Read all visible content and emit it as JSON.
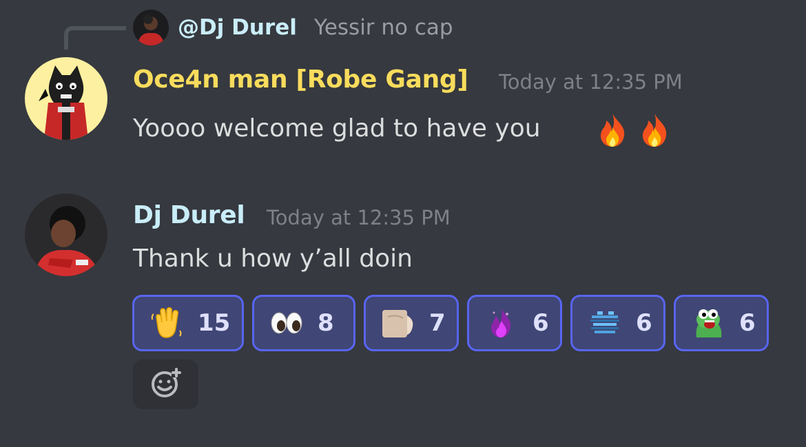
{
  "reply": {
    "mention": "@Dj Durel",
    "text": "Yessir no cap"
  },
  "messages": [
    {
      "author": "Oce4n man [Robe Gang]",
      "author_color": "#f8dc5c",
      "timestamp": "Today at 12:35 PM",
      "text": "Yoooo welcome glad to have you",
      "inline_emojis": [
        "fire-icon",
        "fire-icon"
      ]
    },
    {
      "author": "Dj Durel",
      "author_color": "#c9edf9",
      "timestamp": "Today at 12:35 PM",
      "text": "Thank u how y’all doin"
    }
  ],
  "reactions": [
    {
      "emoji": "waving-hand-icon",
      "count": "15"
    },
    {
      "emoji": "eyes-icon",
      "count": "8"
    },
    {
      "emoji": "fist-custom-emoji",
      "count": "7"
    },
    {
      "emoji": "purple-fire-custom-emoji",
      "count": "6"
    },
    {
      "emoji": "blue-glitch-custom-emoji",
      "count": "6"
    },
    {
      "emoji": "pepe-frog-custom-emoji",
      "count": "6"
    }
  ],
  "colors": {
    "background": "#36393f",
    "reaction_border": "#5865f2",
    "reaction_bg": "#404675",
    "muted": "#7e8187"
  }
}
